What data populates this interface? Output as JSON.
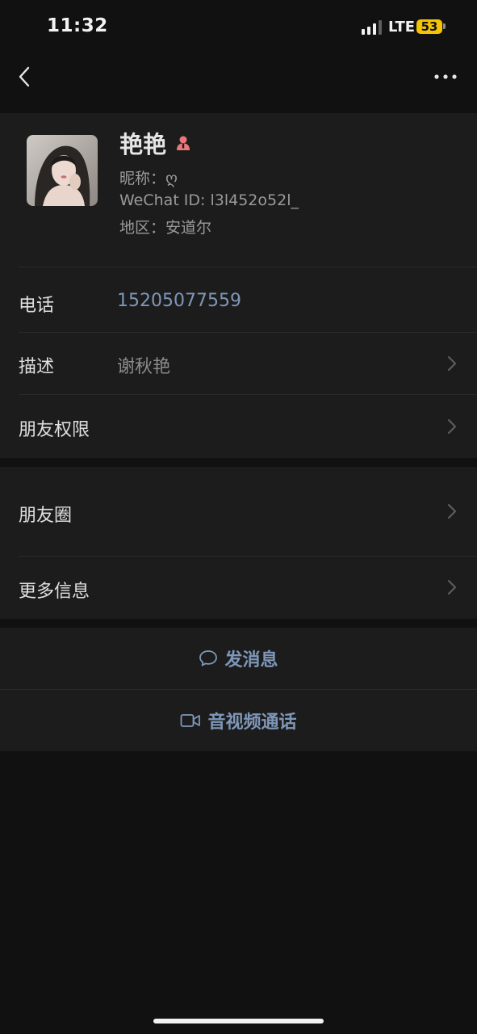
{
  "status_bar": {
    "time": "11:32",
    "network": "LTE",
    "battery": "53"
  },
  "profile": {
    "name": "艳艳",
    "nickname": "昵称：ღ",
    "wechat_id": "WeChat ID: l3l452o52l_",
    "region": "地区：安道尔"
  },
  "rows": {
    "phone": {
      "label": "电话",
      "value": "15205077559"
    },
    "description": {
      "label": "描述",
      "value": "谢秋艳"
    },
    "friend_permissions": {
      "label": "朋友权限"
    },
    "moments": {
      "label": "朋友圈"
    },
    "more_info": {
      "label": "更多信息"
    }
  },
  "actions": {
    "send_message": "发消息",
    "video_call": "音视频通话"
  },
  "colors": {
    "accent": "#7e97b8",
    "background": "#111111",
    "surface": "#1c1c1c",
    "battery": "#f5c400"
  }
}
